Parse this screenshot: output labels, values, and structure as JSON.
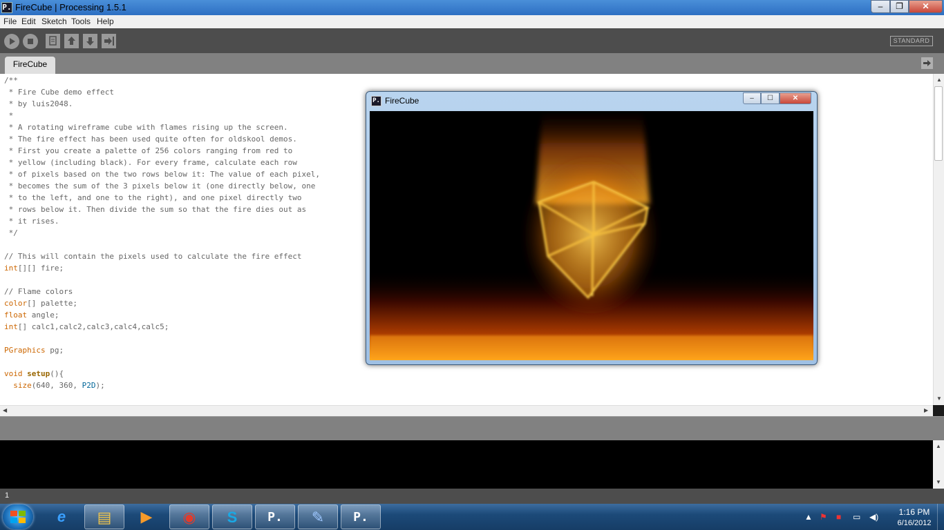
{
  "window": {
    "title": "FireCube | Processing 1.5.1",
    "app_icon": "P.",
    "controls": {
      "minimize": "–",
      "maximize": "❐",
      "close": "✕"
    }
  },
  "menu": [
    "File",
    "Edit",
    "Sketch",
    "Tools",
    "Help"
  ],
  "toolbar": {
    "run_icon": "play-icon",
    "stop_icon": "stop-icon",
    "new_icon": "new-file-icon",
    "open_icon": "open-arrow-up-icon",
    "save_icon": "save-arrow-down-icon",
    "export_icon": "export-icon",
    "mode": "STANDARD"
  },
  "tabs": [
    {
      "label": "FireCube"
    }
  ],
  "editor": {
    "lines": [
      "/**",
      " * Fire Cube demo effect",
      " * by luis2048.",
      " *",
      " * A rotating wireframe cube with flames rising up the screen.",
      " * The fire effect has been used quite often for oldskool demos.",
      " * First you create a palette of 256 colors ranging from red to",
      " * yellow (including black). For every frame, calculate each row",
      " * of pixels based on the two rows below it: The value of each pixel,",
      " * becomes the sum of the 3 pixels below it (one directly below, one",
      " * to the left, and one to the right), and one pixel directly two",
      " * rows below it. Then divide the sum so that the fire dies out as",
      " * it rises.",
      " */",
      "",
      "// This will contain the pixels used to calculate the fire effect",
      "int[][] fire;",
      "",
      "// Flame colors",
      "color[] palette;",
      "float angle;",
      "int[] calc1,calc2,calc3,calc4,calc5;",
      "",
      "PGraphics pg;",
      "",
      "void setup(){",
      "  size(640, 360, P2D);"
    ]
  },
  "status": {
    "line_number": "1"
  },
  "sketch_window": {
    "title": "FireCube",
    "icon": "P.",
    "controls": {
      "minimize": "–",
      "maximize": "☐",
      "close": "✕"
    }
  },
  "taskbar": {
    "items": [
      {
        "name": "internet-explorer-icon",
        "glyph": "e",
        "color": "#3aa0ff"
      },
      {
        "name": "folder-icon",
        "glyph": "▤",
        "color": "#f3c64a"
      },
      {
        "name": "media-player-icon",
        "glyph": "▶",
        "color": "#f59a2a"
      },
      {
        "name": "chrome-icon",
        "glyph": "◉",
        "color": "#e23b2b"
      },
      {
        "name": "skype-icon",
        "glyph": "S",
        "color": "#19a9e5"
      },
      {
        "name": "processing-icon",
        "glyph": "P.",
        "color": "#ffffff"
      },
      {
        "name": "paint-icon",
        "glyph": "✎",
        "color": "#9ec7ff"
      },
      {
        "name": "processing-sketch-icon",
        "glyph": "P.",
        "color": "#ffffff"
      }
    ],
    "clock_time": "1:16 PM",
    "clock_date": "6/16/2012"
  },
  "colors": {
    "toolbar": "#4d4d4d",
    "tabbar": "#818181",
    "keyword": "#cc6600",
    "type_const": "#006699",
    "fire_core": "#ffd24a",
    "fire_edge": "#c85a00"
  }
}
